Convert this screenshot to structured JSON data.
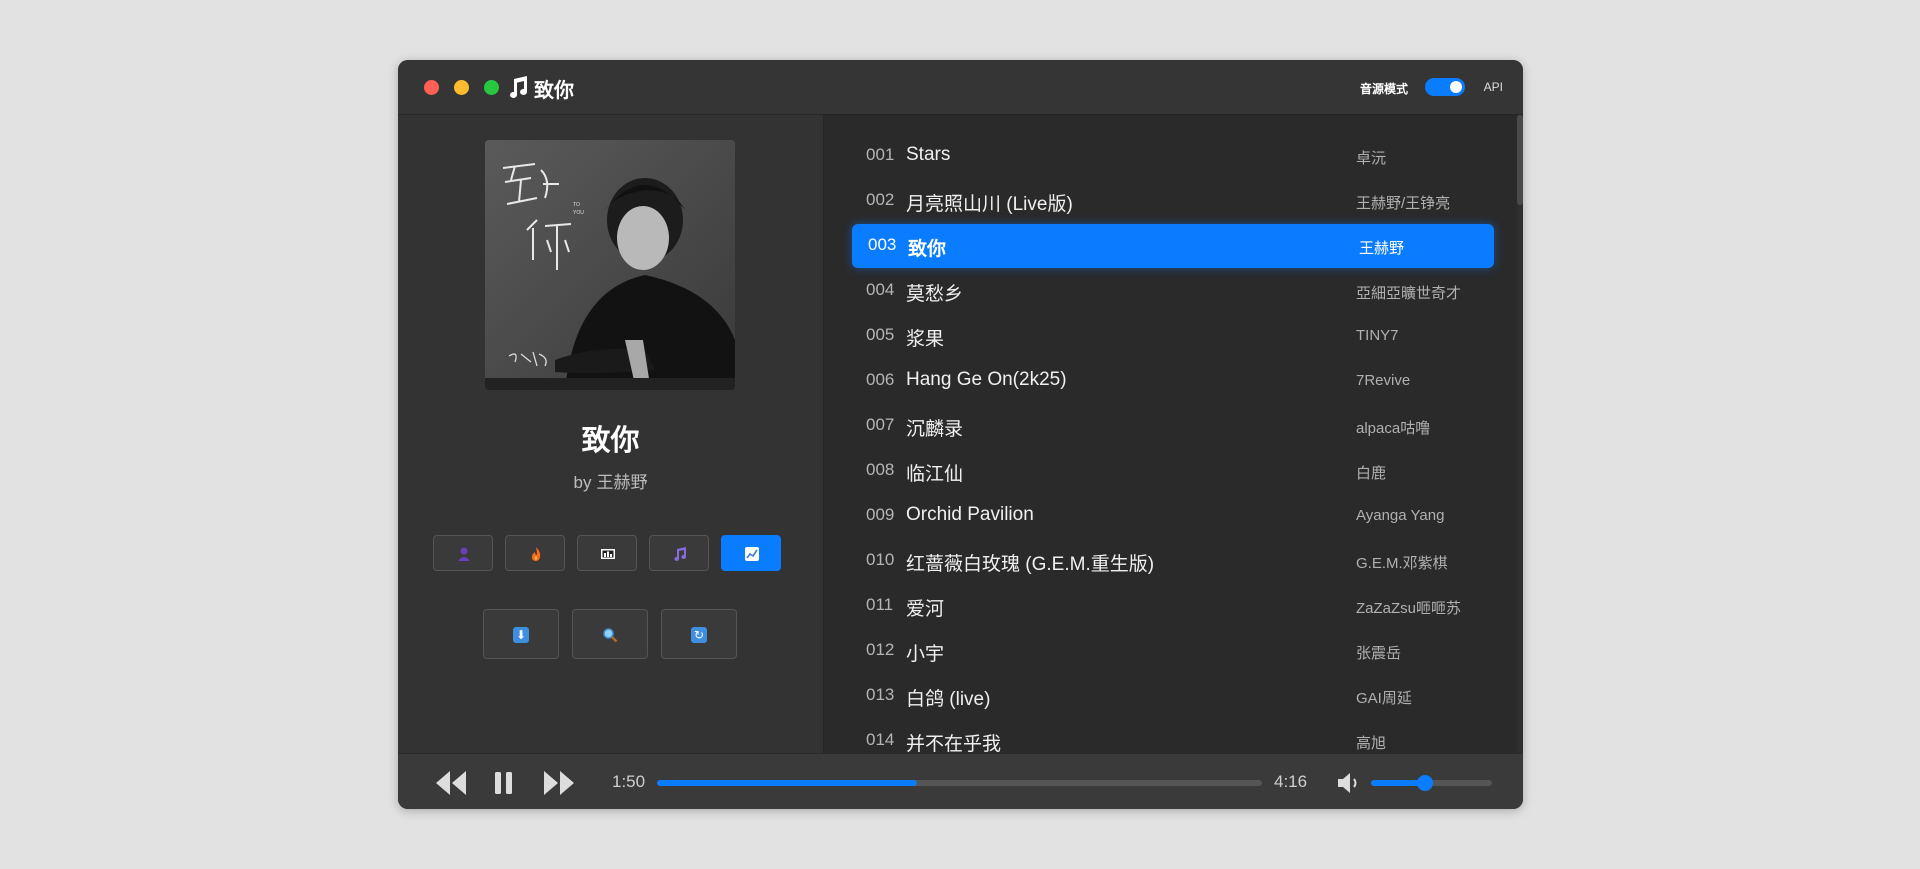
{
  "window": {
    "title": "致你"
  },
  "header": {
    "source_mode_label": "音源模式",
    "source_mode_on": true,
    "api_label": "API"
  },
  "now_playing": {
    "title": "致你",
    "by": "by",
    "artist": "王赫野",
    "cover_text": {
      "handwritten": "致你",
      "to_you": "TO YOU",
      "signature": "王赫野"
    }
  },
  "category_buttons": [
    {
      "icon": "person-icon",
      "active": false
    },
    {
      "icon": "fire-icon",
      "active": false
    },
    {
      "icon": "chart-board-icon",
      "active": false
    },
    {
      "icon": "music-note-icon",
      "active": false
    },
    {
      "icon": "trend-icon",
      "active": true
    }
  ],
  "action_buttons": [
    {
      "icon": "download-icon",
      "glyph": "⬇"
    },
    {
      "icon": "search-icon",
      "glyph": "🔍"
    },
    {
      "icon": "refresh-icon",
      "glyph": "↻"
    }
  ],
  "playlist": {
    "active_index": 2,
    "tracks": [
      {
        "num": "001",
        "name": "Stars",
        "artist": "卓沅"
      },
      {
        "num": "002",
        "name": "月亮照山川 (Live版)",
        "artist": "王赫野/王铮亮"
      },
      {
        "num": "003",
        "name": "致你",
        "artist": "王赫野"
      },
      {
        "num": "004",
        "name": "莫愁乡",
        "artist": "亞細亞曠世奇才"
      },
      {
        "num": "005",
        "name": "浆果",
        "artist": "TINY7"
      },
      {
        "num": "006",
        "name": "Hang Ge On(2k25)",
        "artist": "7Revive"
      },
      {
        "num": "007",
        "name": "沉麟录",
        "artist": "alpaca咕噜"
      },
      {
        "num": "008",
        "name": "临江仙",
        "artist": "白鹿"
      },
      {
        "num": "009",
        "name": "Orchid Pavilion",
        "artist": "Ayanga Yang"
      },
      {
        "num": "010",
        "name": "红蔷薇白玫瑰 (G.E.M.重生版)",
        "artist": "G.E.M.邓紫棋"
      },
      {
        "num": "011",
        "name": "爱河",
        "artist": "ZaZaZsu咂咂苏"
      },
      {
        "num": "012",
        "name": "小宇",
        "artist": "张震岳"
      },
      {
        "num": "013",
        "name": "白鸽 (live)",
        "artist": "GAI周延"
      },
      {
        "num": "014",
        "name": "并不在乎我",
        "artist": "高旭"
      }
    ]
  },
  "player": {
    "current_time": "1:50",
    "total_time": "4:16",
    "progress": 0.43,
    "volume": 0.45
  },
  "colors": {
    "accent": "#0a7cff",
    "window_bg": "#2b2b2b"
  }
}
